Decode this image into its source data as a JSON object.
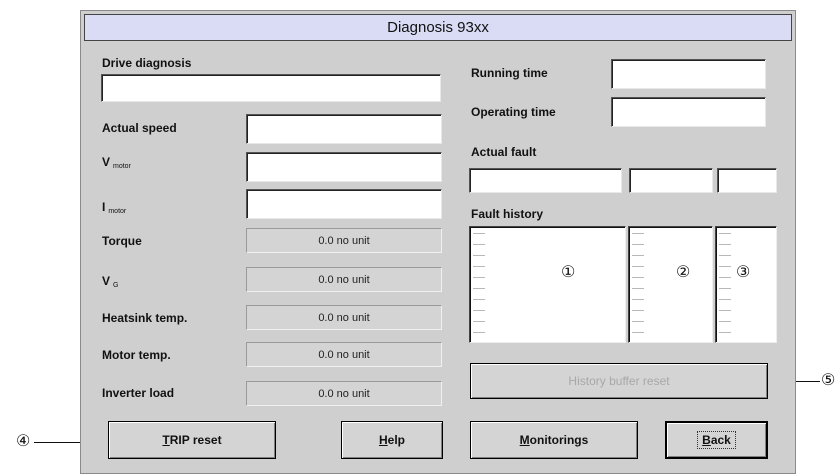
{
  "window": {
    "title": "Diagnosis 93xx"
  },
  "left": {
    "drive_diagnosis_label": "Drive diagnosis",
    "actual_speed_label": "Actual speed",
    "v_motor_label": "V",
    "v_motor_sub": "motor",
    "i_motor_label": "I",
    "i_motor_sub": "motor",
    "torque_label": "Torque",
    "torque_value": "0.0 no unit",
    "vg_label": "V",
    "vg_sub": "G",
    "vg_value": "0.0 no unit",
    "heatsink_label": "Heatsink temp.",
    "heatsink_value": "0.0 no unit",
    "motor_temp_label": "Motor temp.",
    "motor_temp_value": "0.0 no unit",
    "inverter_load_label": "Inverter load",
    "inverter_load_value": "0.0 no unit"
  },
  "right": {
    "running_time_label": "Running time",
    "operating_time_label": "Operating time",
    "actual_fault_label": "Actual fault",
    "fault_history_label": "Fault history",
    "list1_marker": "①",
    "list2_marker": "②",
    "list3_marker": "③",
    "history_reset_label": "History buffer reset"
  },
  "buttons": {
    "trip_reset_mnemonic": "T",
    "trip_reset_rest": "RIP reset",
    "help_mnemonic": "H",
    "help_rest": "elp",
    "monitorings_mnemonic": "M",
    "monitorings_rest": "onitorings",
    "back_mnemonic": "B",
    "back_rest": "ack"
  },
  "callouts": {
    "four": "④",
    "five": "⑤"
  }
}
